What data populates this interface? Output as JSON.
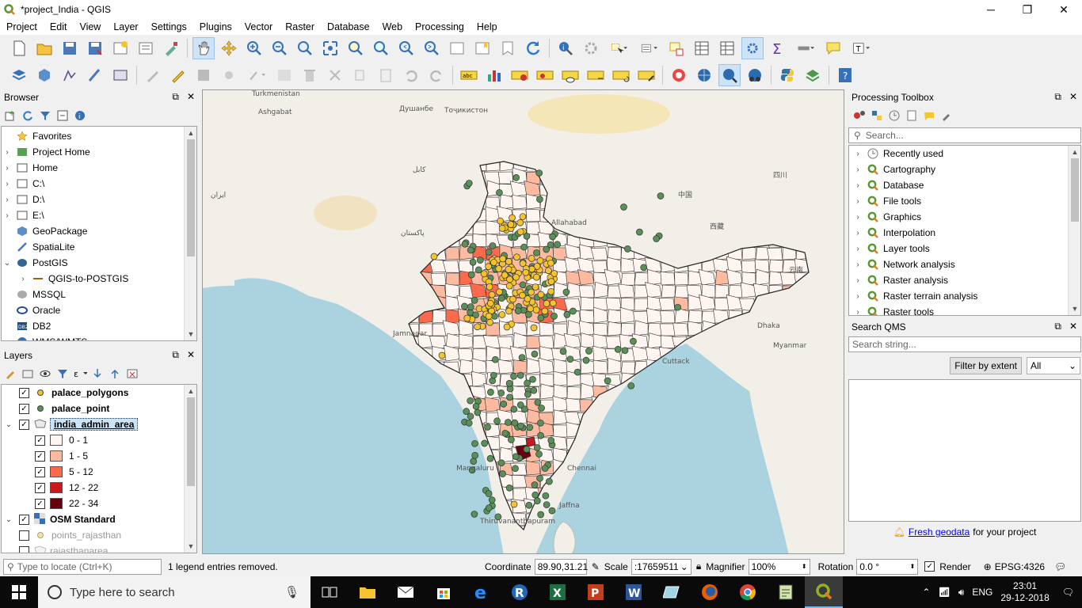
{
  "window": {
    "title": "*project_India - QGIS"
  },
  "menu": [
    "Project",
    "Edit",
    "View",
    "Layer",
    "Settings",
    "Plugins",
    "Vector",
    "Raster",
    "Database",
    "Web",
    "Processing",
    "Help"
  ],
  "browser": {
    "title": "Browser",
    "items": [
      {
        "label": "Favorites",
        "icon": "star-icon",
        "arrow": ""
      },
      {
        "label": "Project Home",
        "icon": "project-home-icon",
        "arrow": "›"
      },
      {
        "label": "Home",
        "icon": "home-folder-icon",
        "arrow": "›"
      },
      {
        "label": "C:\\",
        "icon": "drive-icon",
        "arrow": "›"
      },
      {
        "label": "D:\\",
        "icon": "drive-icon",
        "arrow": "›"
      },
      {
        "label": "E:\\",
        "icon": "drive-icon",
        "arrow": "›"
      },
      {
        "label": "GeoPackage",
        "icon": "geopackage-icon",
        "arrow": ""
      },
      {
        "label": "SpatiaLite",
        "icon": "spatialite-icon",
        "arrow": ""
      },
      {
        "label": "PostGIS",
        "icon": "postgis-icon",
        "arrow": "⌄"
      },
      {
        "label": "QGIS-to-POSTGIS",
        "icon": "connection-icon",
        "arrow": "›",
        "indent": true
      },
      {
        "label": "MSSQL",
        "icon": "mssql-icon",
        "arrow": ""
      },
      {
        "label": "Oracle",
        "icon": "oracle-icon",
        "arrow": ""
      },
      {
        "label": "DB2",
        "icon": "db2-icon",
        "arrow": ""
      },
      {
        "label": "WMS/WMTS",
        "icon": "wms-icon",
        "arrow": ""
      }
    ]
  },
  "layers": {
    "title": "Layers",
    "items": [
      {
        "label": "palace_polygons",
        "checked": true,
        "swatch": "#f4c430",
        "kind": "point",
        "bold": true
      },
      {
        "label": "palace_point",
        "checked": true,
        "swatch": "#5a8f5a",
        "kind": "point",
        "bold": true
      },
      {
        "label": "india_admin_area",
        "checked": true,
        "kind": "polygon",
        "bold": true,
        "selected": true,
        "expanded": true
      },
      {
        "label": "0 - 1",
        "checked": true,
        "swatch": "#fff5f0",
        "kind": "class"
      },
      {
        "label": "1 - 5",
        "checked": true,
        "swatch": "#fcbba1",
        "kind": "class"
      },
      {
        "label": "5 - 12",
        "checked": true,
        "swatch": "#fb6a4a",
        "kind": "class"
      },
      {
        "label": "12 - 22",
        "checked": true,
        "swatch": "#cb181d",
        "kind": "class"
      },
      {
        "label": "22 - 34",
        "checked": true,
        "swatch": "#67000d",
        "kind": "class"
      },
      {
        "label": "OSM Standard",
        "checked": true,
        "kind": "raster",
        "bold": true,
        "expanded": true
      },
      {
        "label": "points_rajasthan",
        "checked": false,
        "swatch": "#f4c430",
        "kind": "point",
        "grey": true
      },
      {
        "label": "rajasthanarea",
        "checked": false,
        "kind": "polygon",
        "grey": true
      }
    ]
  },
  "map_labels": [
    {
      "text": "Turkmenistan"
    },
    {
      "text": "Ashgabat"
    },
    {
      "text": "Душанбе"
    },
    {
      "text": "Тоҷикистон"
    },
    {
      "text": "ایران"
    },
    {
      "text": "کابل"
    },
    {
      "text": "پاکستان"
    },
    {
      "text": "Jamnagar"
    },
    {
      "text": "Mangaluru"
    },
    {
      "text": "Thiruvananthapuram"
    },
    {
      "text": "Jaffna"
    },
    {
      "text": "Chennai"
    },
    {
      "text": "Cuttack"
    },
    {
      "text": "Allahabad"
    },
    {
      "text": "Dhaka"
    },
    {
      "text": "Myanmar"
    },
    {
      "text": "中国"
    },
    {
      "text": "西藏"
    },
    {
      "text": "四川"
    },
    {
      "text": "云南"
    }
  ],
  "processing": {
    "title": "Processing Toolbox",
    "search_placeholder": "Search...",
    "items": [
      "Recently used",
      "Cartography",
      "Database",
      "File tools",
      "Graphics",
      "Interpolation",
      "Layer tools",
      "Network analysis",
      "Raster analysis",
      "Raster terrain analysis",
      "Raster tools"
    ]
  },
  "qms": {
    "title": "Search QMS",
    "search_placeholder": "Search string...",
    "filter_button": "Filter by extent",
    "filter_value": "All",
    "promo_link": "Fresh geodata",
    "promo_text": "for your project"
  },
  "status": {
    "locate_placeholder": "Type to locate (Ctrl+K)",
    "message": "1 legend entries removed.",
    "coordinate_label": "Coordinate",
    "coordinate_value": "89.90,31.21",
    "scale_label": "Scale",
    "scale_value": ":17659511",
    "magnifier_label": "Magnifier",
    "magnifier_value": "100%",
    "rotation_label": "Rotation",
    "rotation_value": "0.0 °",
    "render_label": "Render",
    "crs": "EPSG:4326"
  },
  "taskbar": {
    "search_placeholder": "Type here to search",
    "language": "ENG",
    "time": "23:01",
    "date": "29-12-2018"
  },
  "colors": {
    "class0": "#fff5f0",
    "class1": "#fcbba1",
    "class2": "#fb6a4a",
    "class3": "#cb181d",
    "class4": "#67000d",
    "palace_point": "#5a8f5a",
    "palace_polygon": "#f4c430"
  }
}
